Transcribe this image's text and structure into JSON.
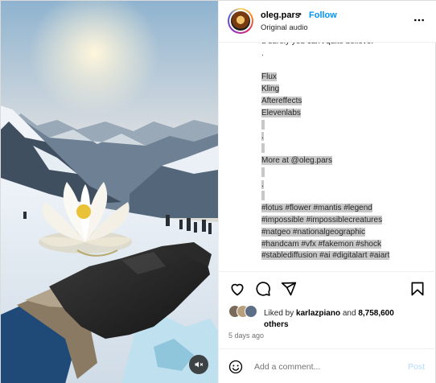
{
  "post": {
    "username": "oleg.pars",
    "separator": "•",
    "follow_label": "Follow",
    "audio_label": "Original audio",
    "more_icon": "more-horizontal-icon",
    "mute_icon": "speaker-muted-icon"
  },
  "caption": {
    "cut_line": "u surely you can't quite believe.",
    "lines": [
      {
        "text": ".",
        "selected": false
      },
      {
        "text": "",
        "selected": false
      },
      {
        "text": "Flux",
        "selected": true
      },
      {
        "text": "Kling",
        "selected": true
      },
      {
        "text": "Aftereffects",
        "selected": true
      },
      {
        "text": "Elevenlabs",
        "selected": true
      },
      {
        "text": "",
        "selected": true
      },
      {
        "text": ".",
        "selected": true
      },
      {
        "text": "",
        "selected": true
      },
      {
        "text": "More at @oleg.pars",
        "selected": true
      },
      {
        "text": "",
        "selected": true
      },
      {
        "text": ".",
        "selected": true
      },
      {
        "text": "",
        "selected": true
      },
      {
        "text": "#lotus #flower #mantis #legend",
        "selected": true
      },
      {
        "text": "#impossible #impossiblecreatures",
        "selected": true
      },
      {
        "text": "#natgeo #nationalgeographic",
        "selected": true
      },
      {
        "text": "#handcam #vfx #fakemon #shock",
        "selected": true
      },
      {
        "text": "#stablediffusion #ai #digitalart #aiart",
        "selected": true
      }
    ]
  },
  "actions": {
    "like_icon": "heart-icon",
    "comment_icon": "comment-icon",
    "share_icon": "share-icon",
    "save_icon": "bookmark-icon"
  },
  "likes": {
    "prefix": "Liked by",
    "user": "karlazpiano",
    "conjunction": "and",
    "count": "8,758,600",
    "suffix": "others"
  },
  "timestamp": "5 days ago",
  "comment": {
    "emoji_icon": "smiley-icon",
    "placeholder": "Add a comment...",
    "post_label": "Post"
  }
}
